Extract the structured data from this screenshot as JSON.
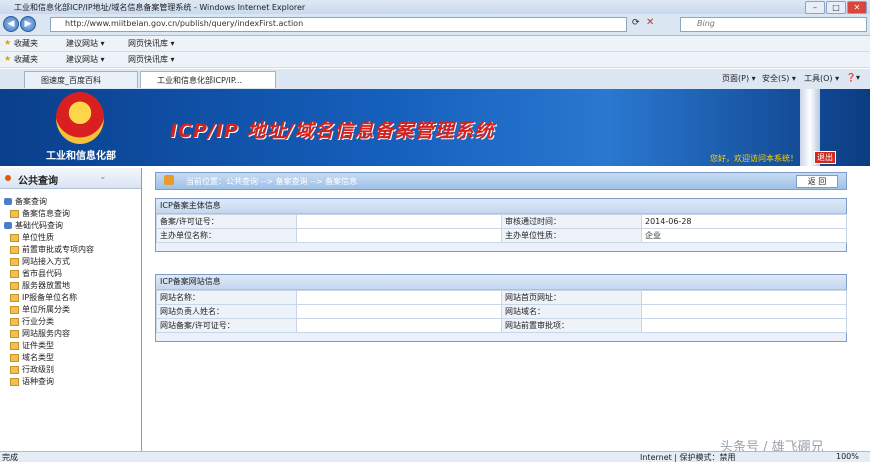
{
  "window": {
    "title": "工业和信息化部ICP/IP地址/域名信息备案管理系统 - Windows Internet Explorer",
    "buttons": [
      "–",
      "□",
      "✕"
    ]
  },
  "address_bar": {
    "url": "http://www.miitbeian.gov.cn/publish/query/indexFirst.action",
    "search_placeholder": "Bing"
  },
  "favorites_rows": [
    {
      "fav_label": "收藏夹",
      "items": [
        "建议网站 ▾",
        "网页快讯库 ▾"
      ]
    },
    {
      "fav_label": "收藏夹",
      "items": [
        "建议网站 ▾",
        "网页快讯库 ▾"
      ]
    }
  ],
  "tabs": [
    {
      "label": "图速度_百度百科"
    },
    {
      "label": "工业和信息化部ICP/IP..."
    }
  ],
  "command_bar": {
    "page": "页面(P) ▾",
    "safety": "安全(S) ▾",
    "tools": "工具(O) ▾",
    "help": "❓▾"
  },
  "banner": {
    "ministry": "工业和信息化部",
    "system_title": "ICP/IP 地址/域名信息备案管理系统",
    "welcome": "您好，欢迎访问本系统！",
    "logout": "退出"
  },
  "sidebar": {
    "title": "公共查询",
    "groups": [
      {
        "label": "备案查询",
        "items": [
          "备案信息查询"
        ]
      },
      {
        "label": "基础代码查询",
        "items": [
          "单位性质",
          "前置审批或专项内容",
          "网站接入方式",
          "省市县代码",
          "服务器放置地",
          "IP报备单位名称",
          "单位所属分类",
          "行业分类",
          "网站服务内容",
          "证件类型",
          "域名类型",
          "行政级别",
          "语种查询"
        ]
      }
    ]
  },
  "breadcrumb": {
    "text": "当前位置：公共查询  -->  备案查询  -->  备案信息",
    "back": "返 回"
  },
  "sponsor_panel": {
    "header": "ICP备案主体信息",
    "rows": [
      {
        "k1": "备案/许可证号：",
        "v1": "",
        "k2": "审核通过时间：",
        "v2": "2014-06-28"
      },
      {
        "k1": "主办单位名称：",
        "v1": "",
        "k2": "主办单位性质：",
        "v2": "企业"
      }
    ]
  },
  "site_panel": {
    "header": "ICP备案网站信息",
    "rows": [
      {
        "k1": "网站名称：",
        "v1": "",
        "k2": "网站首页网址：",
        "v2": ""
      },
      {
        "k1": "网站负责人姓名：",
        "v1": "",
        "k2": "网站域名：",
        "v2": ""
      },
      {
        "k1": "网站备案/许可证号：",
        "v1": "",
        "k2": "网站前置审批项：",
        "v2": ""
      }
    ]
  },
  "status_bar": {
    "left": "完成",
    "zone": "Internet | 保护模式：禁用",
    "zoom": "100%"
  },
  "watermark": "头条号 / 雄飞硼兄"
}
